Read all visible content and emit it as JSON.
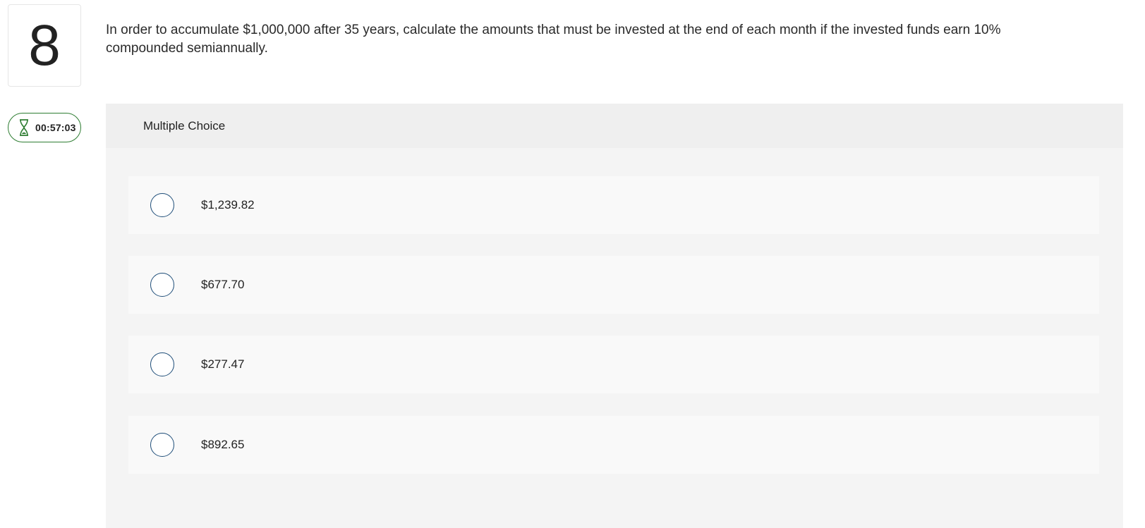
{
  "question": {
    "number": "8",
    "text": "In order to accumulate $1,000,000 after 35 years, calculate the amounts that must be invested at the end of each month if the invested funds earn 10% compounded semiannually."
  },
  "timer": {
    "icon": "hourglass-icon",
    "value": "00:57:03",
    "color": "#2e7d32"
  },
  "multiple_choice": {
    "header": "Multiple Choice",
    "options": [
      {
        "label": "$1,239.82",
        "selected": false
      },
      {
        "label": "$677.70",
        "selected": false
      },
      {
        "label": "$277.47",
        "selected": false
      },
      {
        "label": "$892.65",
        "selected": false
      }
    ]
  },
  "colors": {
    "radio_border": "#1f4e79",
    "panel_bg": "#f4f4f4",
    "option_bg": "#f9f9f9"
  }
}
